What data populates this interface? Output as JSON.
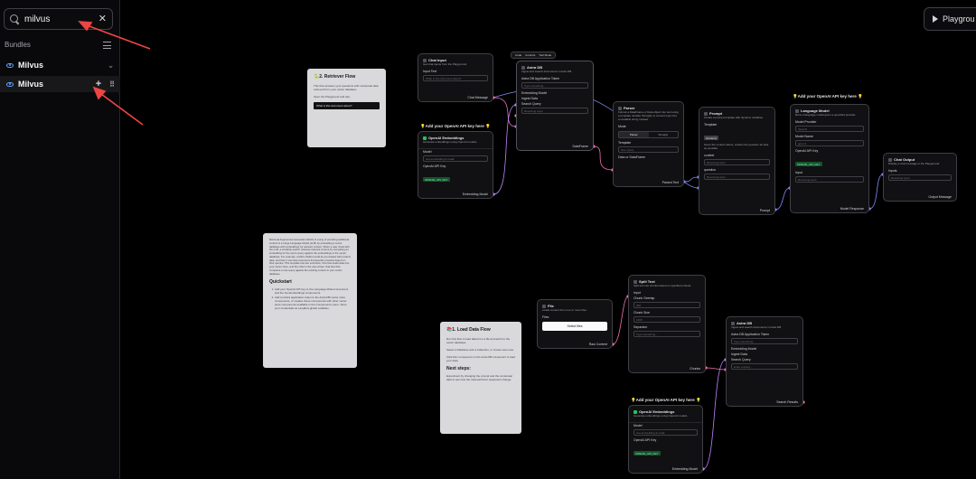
{
  "sidebar": {
    "search": {
      "value": "milvus",
      "placeholder": ""
    },
    "clear_icon": "close-icon",
    "bundles_label": "Bundles",
    "bundle_item": {
      "label": "Milvus"
    },
    "component_item": {
      "label": "Milvus"
    }
  },
  "toolbar": {
    "playground_label": "Playgrou"
  },
  "nodes": {
    "chat_input": {
      "title": "Chat Input",
      "desc": "Get chat inputs from the Playground.",
      "field": "Input Text",
      "placeholder": "What is this document about?",
      "output": "Chat Message"
    },
    "astra_top": {
      "title": "Astra DB",
      "desc": "Ingest and search documents in Astra DB",
      "token": "Astra DB Application Token",
      "token_ph": "Type something...",
      "emb": "Embedding Model",
      "ingest": "Ingest Data",
      "query": "Search Query",
      "query_ph": "Receiving input",
      "output": "DataFrame"
    },
    "mini_toolbar": {
      "code": "Code",
      "controls": "Controls",
      "tool_mode": "Tool Mode"
    },
    "parser": {
      "title": "Parser",
      "desc": "Format a DataFrame or Data object into text using a template. Enable 'Stringify' to convert input into a readable string instead.",
      "mode": "Mode",
      "tab1": "Parser",
      "tab2": "Stringify",
      "template": "Template",
      "template_ph": "Text: {text}",
      "data": "Data or DataFrame",
      "output": "Parsed Text"
    },
    "prompt": {
      "title": "Prompt",
      "desc": "Create a prompt template with dynamic variables.",
      "template": "Template",
      "chip": "{context}",
      "body": "Given the context above, answer the question as best as possible.",
      "context": "context",
      "context_ph": "Receiving input",
      "question": "question",
      "question_ph": "Receiving input",
      "output": "Prompt"
    },
    "lm": {
      "title": "Language Model",
      "desc": "Runs a language model given a specified provider.",
      "provider": "Model Provider",
      "provider_val": "OpenAI",
      "model": "Model Name",
      "model_val": "gpt-4.1",
      "key": "OpenAI API Key",
      "key_val": "OPENAI_API_KEY",
      "input": "Input",
      "input_ph": "Receiving input",
      "output": "Model Response"
    },
    "chat_output": {
      "title": "Chat Output",
      "desc": "Display a chat message in the Playground.",
      "inputs": "Inputs",
      "inputs_ph": "Receiving input",
      "output": "Output Message"
    },
    "emb_top": {
      "title": "OpenAI Embeddings",
      "desc": "Generate embeddings using OpenAI models.",
      "model": "Model",
      "model_val": "text-embedding-3-small",
      "key": "OpenAI API Key",
      "key_val": "OPENAI_API_KEY",
      "output": "Embedding Model"
    },
    "file": {
      "title": "File",
      "desc": "Loads content from one or more files.",
      "files": "Files",
      "button": "Select files",
      "output": "Raw Content"
    },
    "split": {
      "title": "Split Text",
      "desc": "Split text into chunks based on specified criteria.",
      "input": "Input",
      "overlap": "Chunk Overlap",
      "overlap_val": "200",
      "size": "Chunk Size",
      "size_val": "1000",
      "sep": "Separator",
      "sep_ph": "Type something...",
      "output": "Chunks"
    },
    "astra_bottom": {
      "title": "Astra DB",
      "desc": "Ingest and search documents in Astra DB",
      "token": "Astra DB Application Token",
      "token_ph": "Type something...",
      "emb": "Embedding Model",
      "ingest": "Ingest Data",
      "query": "Search Query",
      "query_ph": "Enter a query...",
      "output": "Search Results"
    },
    "emb_bottom": {
      "title": "OpenAI Embeddings",
      "desc": "Generate embeddings using OpenAI models.",
      "model": "Model",
      "model_val": "text-embedding-3-small",
      "key": "OpenAI API Key",
      "key_val": "OPENAI_API_KEY",
      "output": "Embedding Model"
    }
  },
  "labels": {
    "add_key_1": "💡Add your OpenAI API key here 💡",
    "add_key_2": "💡Add your OpenAI API key here 💡",
    "add_key_3": "💡Add your OpenAI API key here 💡"
  },
  "notes": {
    "retriever": {
      "title": "🐍2. Retriever Flow",
      "p1": "This flow answers your questions with contextual data retrieved from your vector database.",
      "p2": "Open the Playground and ask,",
      "code": "What is this document about?"
    },
    "intro": {
      "p1": "Retrieval Augmented Generation (RAG) is a way of providing additional context to a Large Language Model (LLM) by preloading a vector database with embeddings for relevant content. When a user chats with the LLM, a similarity search retrieves relevant content by comparing an embedding for the user's query against the embeddings in the vector database. For example, a RAG chatbot could be pre-loaded with product data, and then it can help customers find specific products based on their queries. This template has two sub-flows. One flow loads data into your vector store, and the other is the user-driven chat flow that compares a new query against the existing content in your vector database.",
      "h": "Quickstart",
      "li1": "Add your OpenAI API key to the Language Model component and the two Embeddings components.",
      "li2": "Add an Astra application token to the Astra DB vector store components, or replace these components with other vector store components available in the Components menu. Store your credentials as Langflow global variables."
    },
    "load": {
      "title": "📚1. Load Data Flow",
      "p1": "Run this flow to load data from a file and add it to the vector database.",
      "p2": "Select a Database and a Collection, or create new ones.",
      "p3": "Click Run component on the Astra DB component to load your data.",
      "h": "Next steps:",
      "p4": "Experiment by changing the prompt and the contextual data to see how the retrieval flow's responses change."
    }
  }
}
